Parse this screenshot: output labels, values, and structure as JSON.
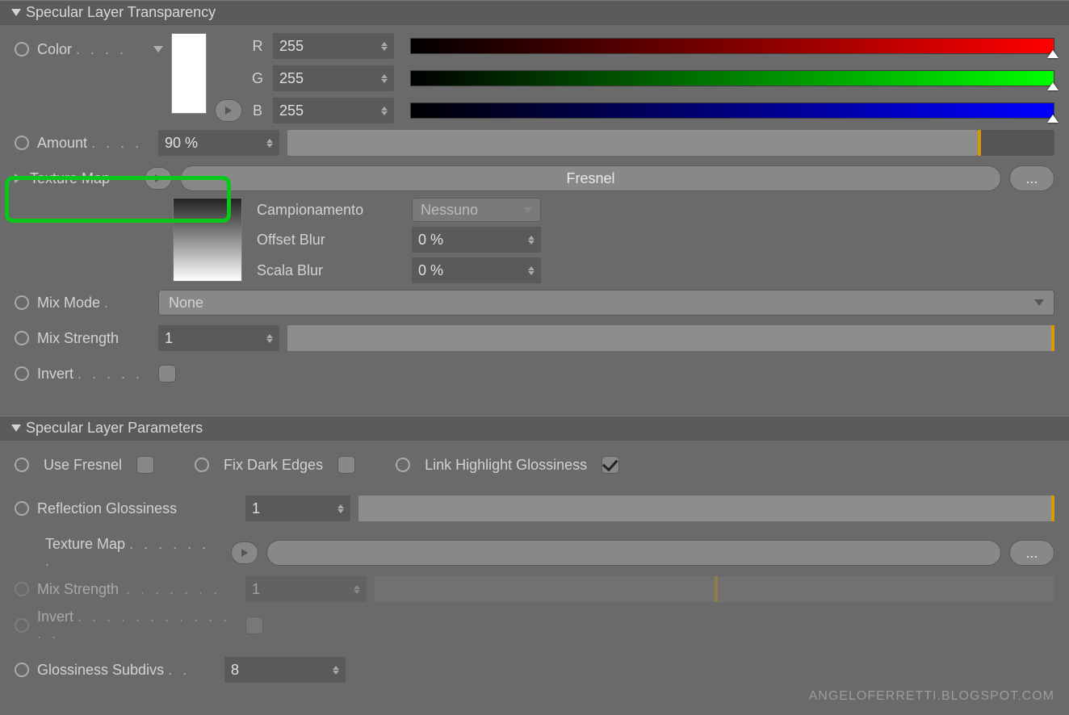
{
  "section1": {
    "title": "Specular Layer Transparency",
    "color": {
      "label": "Color",
      "r_label": "R",
      "r_value": "255",
      "g_label": "G",
      "g_value": "255",
      "b_label": "B",
      "b_value": "255"
    },
    "amount": {
      "label": "Amount",
      "value": "90 %"
    },
    "texture_map": {
      "label": "Texture Map",
      "value": "Fresnel",
      "more": "..."
    },
    "sub": {
      "campionamento_label": "Campionamento",
      "campionamento_value": "Nessuno",
      "offset_blur_label": "Offset Blur",
      "offset_blur_value": "0 %",
      "scala_blur_label": "Scala Blur",
      "scala_blur_value": "0 %"
    },
    "mix_mode": {
      "label": "Mix Mode",
      "value": "None"
    },
    "mix_strength": {
      "label": "Mix Strength",
      "value": "1"
    },
    "invert": {
      "label": "Invert"
    }
  },
  "section2": {
    "title": "Specular Layer Parameters",
    "use_fresnel": "Use Fresnel",
    "fix_dark_edges": "Fix Dark Edges",
    "link_highlight": "Link Highlight Glossiness",
    "reflection_gloss": {
      "label": "Reflection Glossiness",
      "value": "1"
    },
    "texture_map": {
      "label": "Texture Map",
      "more": "..."
    },
    "mix_strength": {
      "label": "Mix Strength",
      "value": "1"
    },
    "invert": {
      "label": "Invert"
    },
    "glossiness_subdivs": {
      "label": "Glossiness Subdivs",
      "value": "8"
    }
  },
  "watermark": "ANGELOFERRETTI.BLOGSPOT.COM"
}
